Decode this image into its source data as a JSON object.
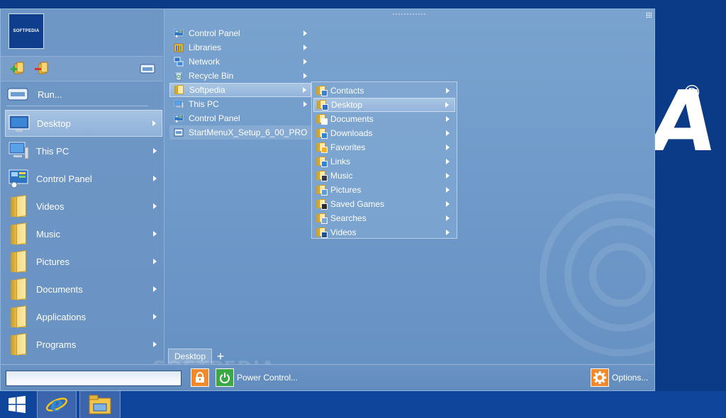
{
  "brand": {
    "avatar_text": "SOFTPEDIA",
    "desktop_logo_letter": "A",
    "registered": "®",
    "watermark": "SOFTPEDIA"
  },
  "colors": {
    "desktop_bg": "#0b3a86",
    "taskbar": "#10459c",
    "menu_bg": "#7aa3cf",
    "selection": "#a9c5e3",
    "power_orange": "#f08a2c",
    "power_green": "#3aa845"
  },
  "run": {
    "label": "Run..."
  },
  "left_menu": {
    "items": [
      {
        "label": "Desktop",
        "icon": "monitor-icon"
      },
      {
        "label": "This PC",
        "icon": "computer-icon"
      },
      {
        "label": "Control Panel",
        "icon": "control-panel-icon"
      },
      {
        "label": "Videos",
        "icon": "folder-icon"
      },
      {
        "label": "Music",
        "icon": "folder-icon"
      },
      {
        "label": "Pictures",
        "icon": "folder-icon"
      },
      {
        "label": "Documents",
        "icon": "folder-icon"
      },
      {
        "label": "Applications",
        "icon": "folder-icon"
      },
      {
        "label": "Programs",
        "icon": "folder-icon"
      }
    ]
  },
  "places": {
    "items": [
      {
        "label": "Control Panel",
        "icon": "control-panel-icon"
      },
      {
        "label": "Libraries",
        "icon": "libraries-icon"
      },
      {
        "label": "Network",
        "icon": "network-icon"
      },
      {
        "label": "Recycle Bin",
        "icon": "recycle-bin-icon"
      },
      {
        "label": "Softpedia",
        "icon": "folder-icon"
      },
      {
        "label": "This PC",
        "icon": "computer-icon"
      },
      {
        "label": "Control Panel",
        "icon": "control-panel-icon"
      },
      {
        "label": "StartMenuX_Setup_6_00_PRO",
        "icon": "installer-icon"
      }
    ]
  },
  "submenu": {
    "items": [
      {
        "label": "Contacts",
        "icon": "contacts-folder-icon"
      },
      {
        "label": "Desktop",
        "icon": "desktop-folder-icon"
      },
      {
        "label": "Documents",
        "icon": "documents-folder-icon"
      },
      {
        "label": "Downloads",
        "icon": "downloads-folder-icon"
      },
      {
        "label": "Favorites",
        "icon": "favorites-folder-icon"
      },
      {
        "label": "Links",
        "icon": "links-folder-icon"
      },
      {
        "label": "Music",
        "icon": "music-folder-icon"
      },
      {
        "label": "Pictures",
        "icon": "pictures-folder-icon"
      },
      {
        "label": "Saved Games",
        "icon": "saved-games-folder-icon"
      },
      {
        "label": "Searches",
        "icon": "searches-folder-icon"
      },
      {
        "label": "Videos",
        "icon": "videos-folder-icon"
      }
    ]
  },
  "tabs": {
    "active": "Desktop",
    "add": "+"
  },
  "search": {
    "value": "",
    "placeholder": ""
  },
  "bottom": {
    "power_label": "Power Control...",
    "options_label": "Options..."
  },
  "taskbar": {
    "items": [
      "windows-start-icon",
      "internet-explorer-icon",
      "file-explorer-icon"
    ]
  }
}
